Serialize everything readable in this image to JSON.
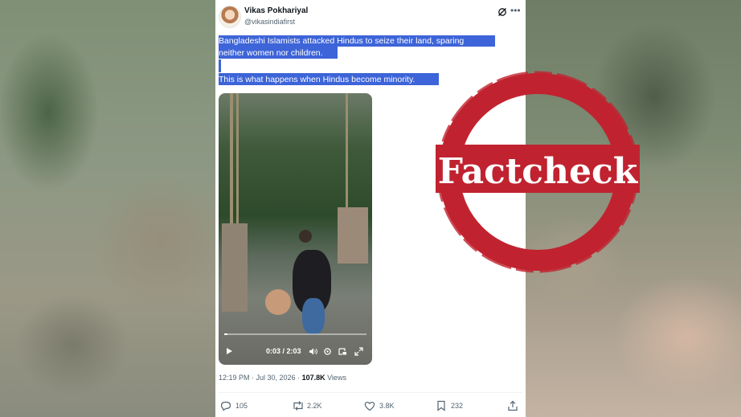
{
  "tweet": {
    "author_name": "Vikas Pokhariyal",
    "author_handle": "@vikasindiafirst",
    "line1": "Bangladeshi Islamists attacked Hindus to seize their land, sparing",
    "line2": "neither women nor children.",
    "line3": "This is what happens when Hindus become minority.",
    "time": "12:19 PM · Jul 30, 2026 · ",
    "views_count": "107.8K",
    "views_label": " Views"
  },
  "video": {
    "time_display": "0:03 / 2:03",
    "progress": 0.024
  },
  "actions": {
    "replies": "105",
    "reposts": "2.2K",
    "likes": "3.8K",
    "bookmarks": "232"
  },
  "stamp": {
    "text": "Factcheck",
    "color": "#c0232f"
  },
  "colors": {
    "highlight": "#3d64d8",
    "text_primary": "#0f1419",
    "text_secondary": "#536471"
  },
  "icons": [
    "grok-icon",
    "more-icon",
    "play-icon",
    "volume-icon",
    "settings-icon",
    "pip-icon",
    "fullscreen-icon",
    "reply-icon",
    "repost-icon",
    "like-icon",
    "bookmark-icon",
    "share-icon"
  ]
}
